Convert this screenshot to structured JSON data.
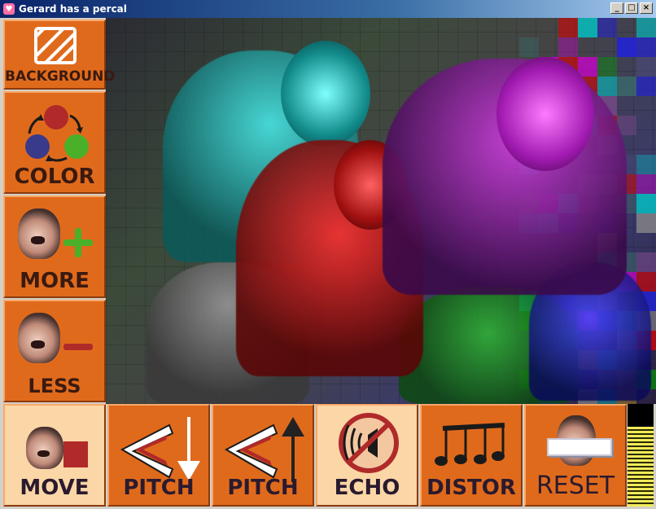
{
  "window": {
    "title": "Gerard has a percal",
    "controls": [
      "_",
      "□",
      "×"
    ]
  },
  "side_buttons": [
    {
      "id": "background",
      "label": "BACKGROUND",
      "icon": "hatched-square-icon"
    },
    {
      "id": "color",
      "label": "COLOR",
      "icon": "color-cycle-icon"
    },
    {
      "id": "more",
      "label": "MORE",
      "icon": "face-plus-icon"
    },
    {
      "id": "less",
      "label": "LESS",
      "icon": "face-minus-icon"
    }
  ],
  "bottom_buttons": [
    {
      "id": "move",
      "label": "MOVE",
      "icon": "face-stop-icon",
      "active": true
    },
    {
      "id": "pitch-down",
      "label": "PITCH",
      "icon": "pitch-down-icon",
      "active": false
    },
    {
      "id": "pitch-up",
      "label": "PITCH",
      "icon": "pitch-up-icon",
      "active": false
    },
    {
      "id": "echo",
      "label": "ECHO",
      "icon": "no-echo-icon",
      "active": true
    },
    {
      "id": "distor",
      "label": "DISTOR",
      "icon": "music-notes-icon",
      "active": false
    },
    {
      "id": "reset",
      "label": "RESET",
      "icon": "face-eraser-icon",
      "active": false
    }
  ],
  "level_meter": {
    "level": 0.78
  },
  "colors": {
    "button_orange": "#e06a1c",
    "button_active": "#fbd6a6",
    "meter_fill": "#f2ea5a",
    "figure_tints": [
      "#00c8c8",
      "#d000d0",
      "#e00000",
      "#00a000",
      "#2020e0",
      "#888888"
    ]
  }
}
